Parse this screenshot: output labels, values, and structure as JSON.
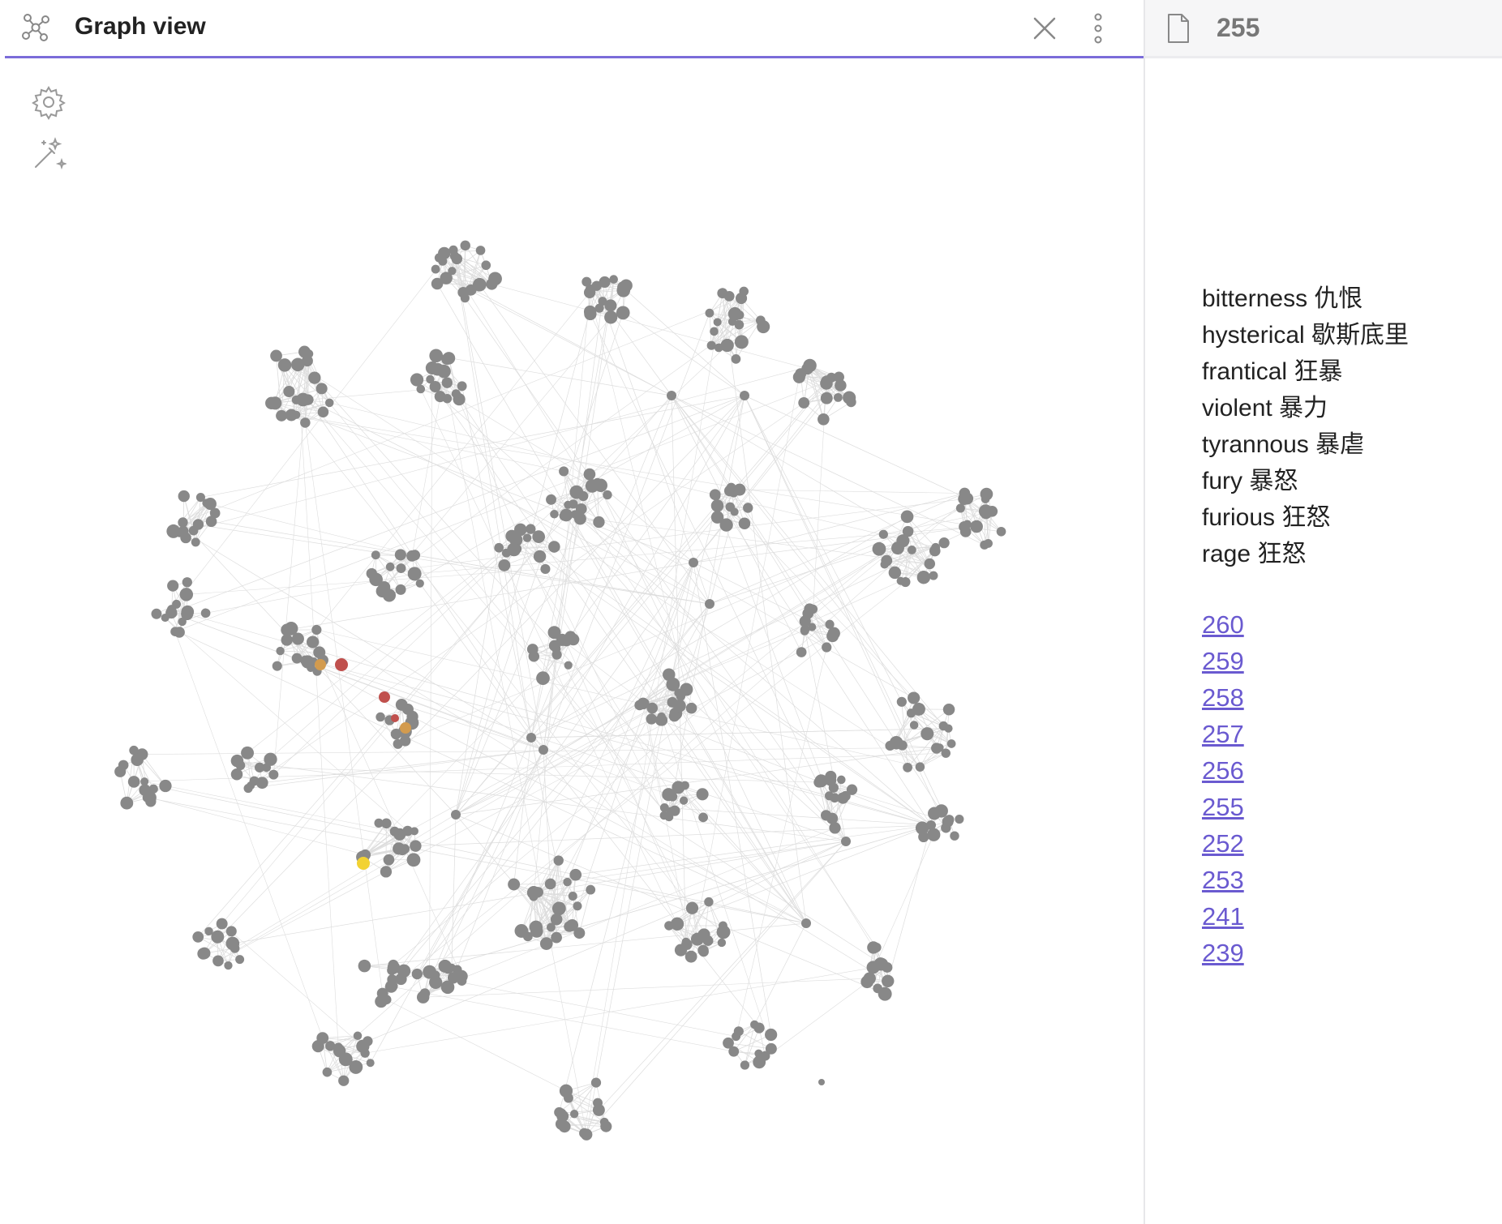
{
  "graph_view": {
    "title": "Graph view",
    "icons": {
      "header": "graph-icon",
      "close": "close-icon",
      "more": "more-vertical-icon",
      "settings": "gear-icon",
      "animate": "magic-wand-icon"
    },
    "accent_color": "#7b6cd9",
    "node_color": "#888888",
    "edge_color": "#dddddd",
    "highlight_colors": [
      "#c0504d",
      "#d39b4e",
      "#f2d233"
    ]
  },
  "note": {
    "title": "255",
    "icon": "file-icon",
    "lines": [
      "bitterness 仇恨",
      "hysterical 歇斯底里",
      "frantical 狂暴",
      "violent 暴力",
      "tyrannous 暴虐",
      "fury 暴怒",
      "furious 狂怒",
      "rage 狂怒"
    ],
    "links": [
      "260",
      "259",
      "258",
      "257",
      "256",
      "255",
      "252",
      "253",
      "241",
      "239"
    ],
    "link_color": "#6a5ad0"
  }
}
